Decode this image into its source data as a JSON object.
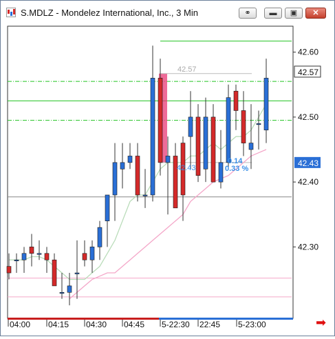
{
  "window": {
    "title": "S.MDLZ - Mondelez International, Inc., 3 Min",
    "buttons": [
      "link",
      "minimize",
      "restore",
      "close"
    ]
  },
  "colors": {
    "up": "#2a6fd6",
    "down": "#d42a2a",
    "green_line": "#22c322",
    "ma_light": "#b9dcb9",
    "ma_pink": "#f4a6c8",
    "annotation_blue": "#3a8fe8",
    "price_label_bg": "#2a6fd6"
  },
  "chart_data": {
    "type": "candlestick",
    "symbol": "S.MDLZ",
    "interval": "3 Min",
    "ylim": [
      42.19,
      42.64
    ],
    "y_ticks": [
      "42.60",
      "42.50",
      "42.40",
      "42.30"
    ],
    "x_ticks": [
      "04:00",
      "04:15",
      "04:30",
      "04:45",
      "5-22:30",
      "22:45",
      "5-23:00"
    ],
    "last_price": "42.57",
    "crosshair_price": "42.43",
    "candles": [
      {
        "o": 42.27,
        "h": 42.29,
        "l": 42.25,
        "c": 42.26
      },
      {
        "o": 42.28,
        "h": 42.29,
        "l": 42.26,
        "c": 42.28
      },
      {
        "o": 42.28,
        "h": 42.3,
        "l": 42.26,
        "c": 42.29
      },
      {
        "o": 42.3,
        "h": 42.32,
        "l": 42.27,
        "c": 42.29
      },
      {
        "o": 42.29,
        "h": 42.31,
        "l": 42.28,
        "c": 42.29
      },
      {
        "o": 42.29,
        "h": 42.3,
        "l": 42.26,
        "c": 42.28
      },
      {
        "o": 42.28,
        "h": 42.29,
        "l": 42.24,
        "c": 42.24
      },
      {
        "o": 42.23,
        "h": 42.26,
        "l": 42.22,
        "c": 42.23
      },
      {
        "o": 42.23,
        "h": 42.26,
        "l": 42.21,
        "c": 42.24
      },
      {
        "o": 42.26,
        "h": 42.31,
        "l": 42.22,
        "c": 42.26
      },
      {
        "o": 42.29,
        "h": 42.31,
        "l": 42.27,
        "c": 42.28
      },
      {
        "o": 42.28,
        "h": 42.31,
        "l": 42.26,
        "c": 42.3
      },
      {
        "o": 42.3,
        "h": 42.34,
        "l": 42.28,
        "c": 42.33
      },
      {
        "o": 42.34,
        "h": 42.38,
        "l": 42.3,
        "c": 42.38
      },
      {
        "o": 42.38,
        "h": 42.46,
        "l": 42.34,
        "c": 42.43
      },
      {
        "o": 42.42,
        "h": 42.46,
        "l": 42.39,
        "c": 42.43
      },
      {
        "o": 42.43,
        "h": 42.46,
        "l": 42.42,
        "c": 42.44
      },
      {
        "o": 42.44,
        "h": 42.46,
        "l": 42.37,
        "c": 42.38
      },
      {
        "o": 42.38,
        "h": 42.42,
        "l": 42.36,
        "c": 42.38
      },
      {
        "o": 42.38,
        "h": 42.61,
        "l": 42.37,
        "c": 42.56
      },
      {
        "o": 42.56,
        "h": 42.59,
        "l": 42.41,
        "c": 42.43
      },
      {
        "o": 42.43,
        "h": 42.47,
        "l": 42.35,
        "c": 42.44
      },
      {
        "o": 42.44,
        "h": 42.46,
        "l": 42.36,
        "c": 42.36
      },
      {
        "o": 42.46,
        "h": 42.47,
        "l": 42.34,
        "c": 42.38
      },
      {
        "o": 42.47,
        "h": 42.54,
        "l": 42.42,
        "c": 42.5
      },
      {
        "o": 42.5,
        "h": 42.52,
        "l": 42.4,
        "c": 42.41
      },
      {
        "o": 42.42,
        "h": 42.53,
        "l": 42.4,
        "c": 42.5
      },
      {
        "o": 42.5,
        "h": 42.52,
        "l": 42.4,
        "c": 42.4
      },
      {
        "o": 42.4,
        "h": 42.48,
        "l": 42.39,
        "c": 42.43
      },
      {
        "o": 42.43,
        "h": 42.55,
        "l": 42.42,
        "c": 42.53
      },
      {
        "o": 42.54,
        "h": 42.55,
        "l": 42.48,
        "c": 42.51
      },
      {
        "o": 42.51,
        "h": 42.54,
        "l": 42.44,
        "c": 42.46
      },
      {
        "o": 42.45,
        "h": 42.52,
        "l": 42.42,
        "c": 42.46
      },
      {
        "o": 42.49,
        "h": 42.51,
        "l": 42.45,
        "c": 42.49
      },
      {
        "o": 42.48,
        "h": 42.59,
        "l": 42.46,
        "c": 42.56
      }
    ],
    "ma_light": [
      42.28,
      42.28,
      42.28,
      42.285,
      42.285,
      42.28,
      42.27,
      42.26,
      42.25,
      42.25,
      42.25,
      42.26,
      42.27,
      42.29,
      42.31,
      42.34,
      42.37,
      42.38,
      42.38,
      42.4,
      42.42,
      42.43,
      42.43,
      42.43,
      42.44,
      42.44,
      42.45,
      42.46,
      42.45,
      42.46,
      42.47,
      42.47,
      42.48,
      42.5,
      42.52
    ],
    "ma_pink": [
      null,
      null,
      null,
      null,
      null,
      null,
      null,
      null,
      42.22,
      42.23,
      42.24,
      42.25,
      42.255,
      42.26,
      42.26,
      42.27,
      42.28,
      42.29,
      42.3,
      42.31,
      42.32,
      42.33,
      42.34,
      42.35,
      42.37,
      42.38,
      42.39,
      42.4,
      42.405,
      42.41,
      42.42,
      42.43,
      42.44,
      42.445,
      42.45
    ],
    "h_lines": [
      {
        "price": 42.617,
        "color": "#22c322",
        "x_start": 0.535
      },
      {
        "price": 42.555,
        "color": "#22c322",
        "dashed": true
      },
      {
        "price": 42.525,
        "color": "#22c322"
      },
      {
        "price": 42.495,
        "color": "#22c322",
        "dashed": true
      },
      {
        "price": 42.377,
        "color": "#888888"
      },
      {
        "price": 42.252,
        "color": "#f4a6c8"
      },
      {
        "price": 42.223,
        "color": "#f4a6c8"
      }
    ],
    "annotations": {
      "high_label": "42.57",
      "low_label": "42.43",
      "change_label": "0.14",
      "percent_label": "0.33 %"
    }
  }
}
